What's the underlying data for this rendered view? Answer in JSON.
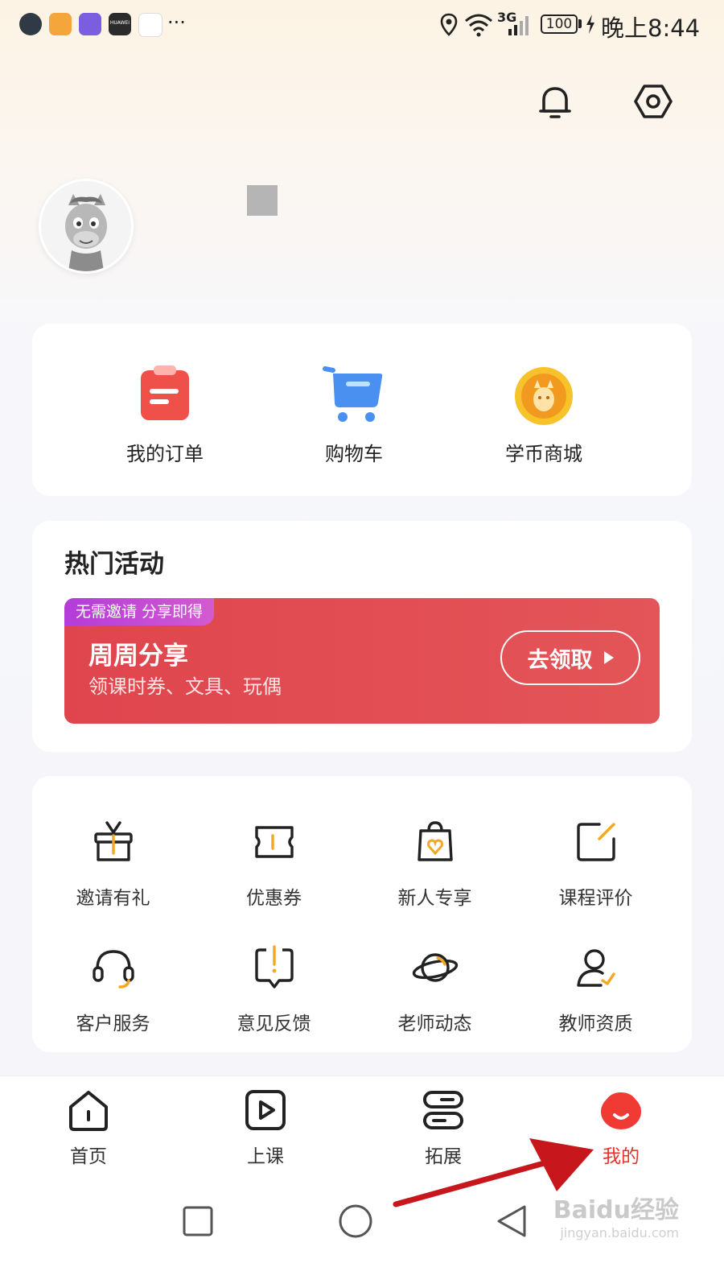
{
  "status_bar": {
    "time": "晚上8:44",
    "battery": "100",
    "network": "3G",
    "app_icons": [
      "messages-icon",
      "package-icon",
      "album-icon",
      "huawei-icon",
      "compass-icon"
    ],
    "more": "···",
    "huawei_label": "HUAWEI"
  },
  "header": {
    "bell_icon": "bell-icon",
    "settings_icon": "hexagon-settings-icon"
  },
  "profile": {
    "avatar_icon": "pony-avatar"
  },
  "quick_actions": [
    {
      "label": "我的订单",
      "icon": "order-clipboard-icon",
      "color": "#f0504a"
    },
    {
      "label": "购物车",
      "icon": "shopping-cart-icon",
      "color": "#4a90f0"
    },
    {
      "label": "学币商城",
      "icon": "coin-icon",
      "color": "#f7a824"
    }
  ],
  "activities": {
    "title": "热门活动",
    "banner": {
      "tag": "无需邀请 分享即得",
      "title": "周周分享",
      "subtitle": "领课时券、文具、玩偶",
      "button": "去领取"
    }
  },
  "services": [
    {
      "label": "邀请有礼",
      "icon": "gift-icon"
    },
    {
      "label": "优惠券",
      "icon": "coupon-icon"
    },
    {
      "label": "新人专享",
      "icon": "bag-heart-icon"
    },
    {
      "label": "课程评价",
      "icon": "edit-icon"
    },
    {
      "label": "客户服务",
      "icon": "headset-icon"
    },
    {
      "label": "意见反馈",
      "icon": "feedback-icon"
    },
    {
      "label": "老师动态",
      "icon": "planet-icon"
    },
    {
      "label": "教师资质",
      "icon": "teacher-check-icon"
    }
  ],
  "tabs": [
    {
      "label": "首页",
      "icon": "home-icon",
      "active": false
    },
    {
      "label": "上课",
      "icon": "play-icon",
      "active": false
    },
    {
      "label": "拓展",
      "icon": "extend-icon",
      "active": false
    },
    {
      "label": "我的",
      "icon": "me-icon",
      "active": true
    }
  ],
  "colors": {
    "accent": "#f0504a",
    "active_tab": "#e8322d",
    "icon_orange": "#f5a623"
  },
  "watermark": {
    "brand": "Baidu经验",
    "url": "jingyan.baidu.com"
  }
}
